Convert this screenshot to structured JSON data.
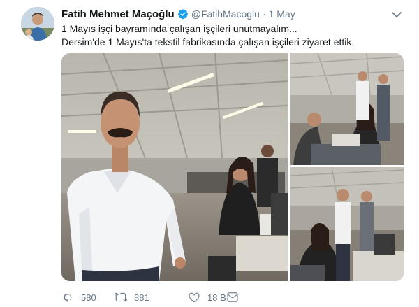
{
  "tweet": {
    "author": {
      "name": "Fatih Mehmet Maçoğlu",
      "handle": "@FatihMacoglu",
      "separator": "·",
      "date": "1 May"
    },
    "lines": [
      "1 Mayıs işçi bayramında çalışan işçileri unutmayalım...",
      "Dersim'de 1 Mayıs'ta tekstil fabrikasında çalışan işçileri ziyaret ettik."
    ],
    "actions": {
      "replies": "580",
      "retweets": "881",
      "likes": "18 B"
    }
  },
  "icons": {
    "verified": "verified-badge-icon",
    "caret": "chevron-down-icon",
    "reply": "reply-icon",
    "retweet": "retweet-icon",
    "like": "heart-icon",
    "dm": "envelope-icon"
  },
  "colors": {
    "text": "#14171a",
    "muted": "#657786",
    "verified": "#1da1f2"
  }
}
